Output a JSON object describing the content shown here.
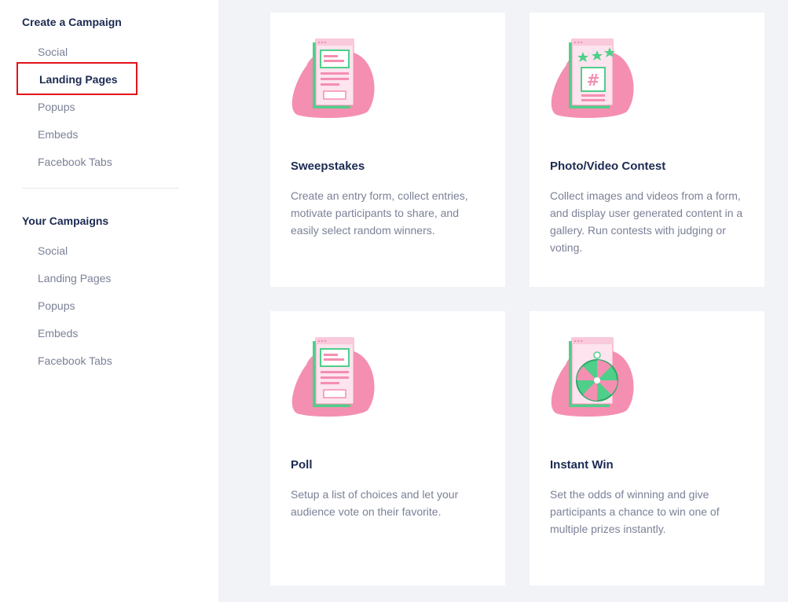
{
  "sidebar": {
    "create_title": "Create a Campaign",
    "create_items": [
      "Social",
      "Landing Pages",
      "Popups",
      "Embeds",
      "Facebook Tabs"
    ],
    "active_item": "Landing Pages",
    "yours_title": "Your Campaigns",
    "your_items": [
      "Social",
      "Landing Pages",
      "Popups",
      "Embeds",
      "Facebook Tabs"
    ]
  },
  "cards": [
    {
      "title": "Sweepstakes",
      "description": "Create an entry form, collect entries, motivate participants to share, and easily select random winners.",
      "icon": "sweepstakes-illustration"
    },
    {
      "title": "Photo/Video Contest",
      "description": "Collect images and videos from a form, and display user generated content in a gallery. Run contests with judging or voting.",
      "icon": "photo-contest-illustration"
    },
    {
      "title": "Poll",
      "description": "Setup a list of choices and let your audience vote on their favorite.",
      "icon": "poll-illustration"
    },
    {
      "title": "Instant Win",
      "description": "Set the odds of winning and give participants a chance to win one of multiple prizes instantly.",
      "icon": "instant-win-illustration"
    }
  ],
  "colors": {
    "accent_pink": "#f48fb1",
    "accent_green": "#4fcf8a",
    "navy": "#1c2a52",
    "highlight_red": "#e3141b"
  }
}
